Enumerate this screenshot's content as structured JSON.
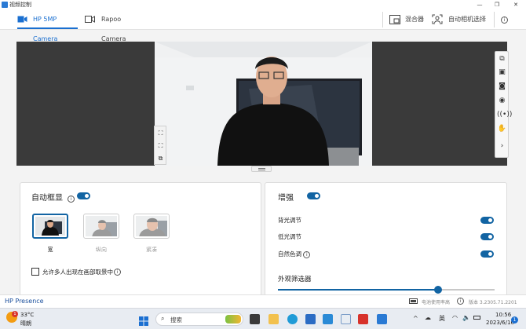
{
  "window": {
    "title": "视频控制"
  },
  "tabs": [
    {
      "label": "HP 5MP Camera",
      "active": true
    },
    {
      "label": "Rapoo Camera",
      "active": false
    }
  ],
  "header_actions": {
    "mixer_label": "混合器",
    "auto_select_label": "自动相机选择"
  },
  "auto_framing": {
    "title": "自动框显",
    "enabled": true,
    "options": [
      {
        "label": "宽",
        "selected": true
      },
      {
        "label": "纵向",
        "selected": false
      },
      {
        "label": "紧凑",
        "selected": false
      }
    ],
    "multi_person_label": "允许多人出现在画部取景中",
    "multi_person_checked": false
  },
  "enhance": {
    "title": "增强",
    "enabled": true,
    "settings": [
      {
        "label": "背光调节",
        "enabled": true
      },
      {
        "label": "低光调节",
        "enabled": true
      },
      {
        "label": "自然色调",
        "enabled": true
      }
    ],
    "filter_title": "外观筛选器",
    "filter_level": 0.74
  },
  "status": {
    "brand": "HP Presence",
    "power_text": "电池使用率高",
    "version": "版本 3.2305.71.2201"
  },
  "taskbar": {
    "weather_temp": "33°C",
    "weather_desc": "晴朗",
    "weather_badge": "1",
    "search_placeholder": "搜索",
    "ime": "英",
    "time": "10:56",
    "date": "2023/6/16",
    "notification_count": "1"
  },
  "colors": {
    "accent": "#1264a3",
    "tab_active": "#1a6fd0"
  }
}
